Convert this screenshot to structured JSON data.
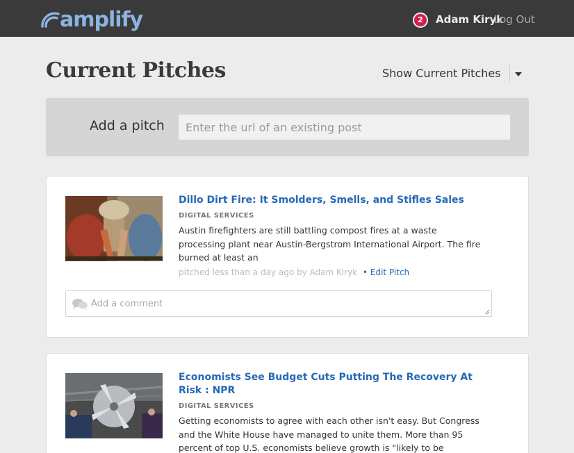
{
  "header": {
    "logo_text": "amplify",
    "notification_count": "2",
    "user_name": "Adam Kiryk",
    "logout_label": "Log Out"
  },
  "page": {
    "title": "Current Pitches",
    "filter_label": "Show Current Pitches"
  },
  "add_pitch": {
    "label": "Add a pitch",
    "placeholder": "Enter the url of an existing post"
  },
  "pitches": [
    {
      "title": "Dillo Dirt Fire: It Smolders, Smells, and Stifles Sales",
      "category": "DIGITAL SERVICES",
      "description": "Austin firefighters are still battling compost fires at a waste processing plant near Austin-Bergstrom International Airport. The fire burned at least an",
      "meta": "pitched less than a day ago by Adam Kiryk",
      "edit_label": "• Edit Pitch",
      "comment_placeholder": "Add a comment"
    },
    {
      "title": "Economists See Budget Cuts Putting The Recovery At Risk : NPR",
      "category": "DIGITAL SERVICES",
      "description": "Getting economists to agree with each other isn't easy. But Congress and the White House have managed to unite them. More than 95 percent of top U.S. economists believe growth is \"likely to be negatively affected\" by"
    }
  ],
  "colors": {
    "topbar": "#3a3a3a",
    "brand": "#8cb4df",
    "link": "#2569b6",
    "badge": "#d21e4a"
  }
}
